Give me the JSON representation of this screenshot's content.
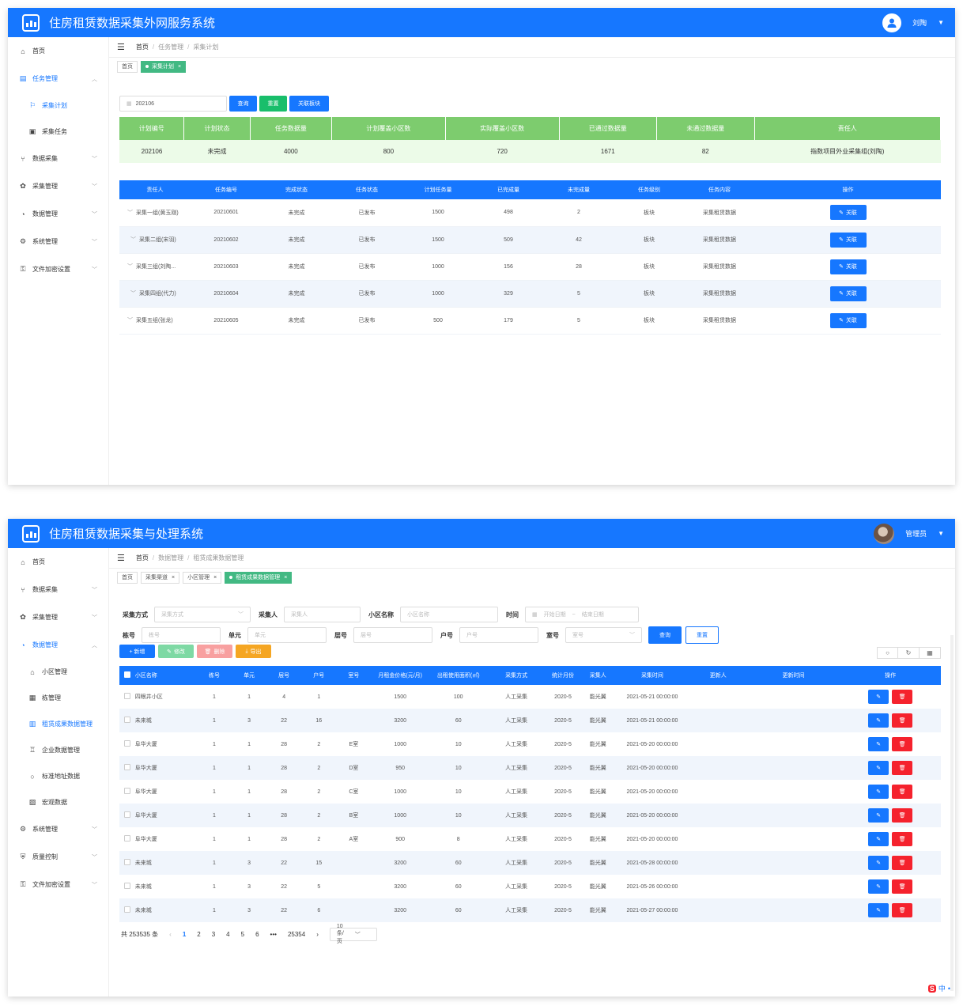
{
  "w1": {
    "title": "住房租赁数据采集外网服务系统",
    "user": "刘陶",
    "menu": [
      {
        "label": "首页",
        "icon": "home-icon",
        "glyph": "⌂"
      },
      {
        "label": "任务管理",
        "icon": "clipboard-icon",
        "glyph": "▤",
        "active": true,
        "chev": "︿"
      },
      {
        "label": "采集计划",
        "icon": "flag-icon",
        "glyph": "⚐",
        "sub": true,
        "active": true
      },
      {
        "label": "采集任务",
        "icon": "calendar-icon",
        "glyph": "▣",
        "sub": true
      },
      {
        "label": "数据采集",
        "icon": "branch-icon",
        "glyph": "⑂",
        "chev": "﹀"
      },
      {
        "label": "采集管理",
        "icon": "gear-icon",
        "glyph": "✿",
        "chev": "﹀"
      },
      {
        "label": "数据管理",
        "icon": "pie-icon",
        "glyph": "◔",
        "chev": "﹀"
      },
      {
        "label": "系统管理",
        "icon": "settings-icon",
        "glyph": "⚙",
        "chev": "﹀"
      },
      {
        "label": "文件加密设置",
        "icon": "lock-icon",
        "glyph": "⚿",
        "chev": "﹀"
      }
    ],
    "crumbs": [
      "首页",
      "任务管理",
      "采集计划"
    ],
    "tabs": [
      {
        "label": "首页"
      },
      {
        "label": "采集计划",
        "on": true
      }
    ],
    "search_value": "202106",
    "buttons": [
      "查询",
      "重置",
      "关联板块"
    ],
    "plan_headers": [
      "计划编号",
      "计划状态",
      "任务数据量",
      "计划覆盖小区数",
      "实际覆盖小区数",
      "已通过数据量",
      "未通过数据量",
      "责任人"
    ],
    "plan_row": [
      "202106",
      "未完成",
      "4000",
      "800",
      "720",
      "1671",
      "82",
      "指数项目外业采集组(刘陶)"
    ],
    "task_headers": [
      "责任人",
      "任务编号",
      "完成状态",
      "任务状态",
      "计划任务量",
      "已完成量",
      "未完成量",
      "任务级别",
      "任务内容",
      "操作"
    ],
    "task_rows": [
      [
        "采集一组(黄玉刚)",
        "20210601",
        "未完成",
        "已发布",
        "1500",
        "498",
        "2",
        "板块",
        "采集租赁数据"
      ],
      [
        "采集二组(宋羽)",
        "20210602",
        "未完成",
        "已发布",
        "1500",
        "509",
        "42",
        "板块",
        "采集租赁数据"
      ],
      [
        "采集三组(刘陶...",
        "20210603",
        "未完成",
        "已发布",
        "1000",
        "156",
        "28",
        "板块",
        "采集租赁数据"
      ],
      [
        "采集四组(代力)",
        "20210604",
        "未完成",
        "已发布",
        "1000",
        "329",
        "5",
        "板块",
        "采集租赁数据"
      ],
      [
        "采集五组(张龙)",
        "20210605",
        "未完成",
        "已发布",
        "500",
        "179",
        "5",
        "板块",
        "采集租赁数据"
      ]
    ],
    "action_label": "关联"
  },
  "w2": {
    "title": "住房租赁数据采集与处理系统",
    "user": "管理员",
    "menu": [
      {
        "label": "首页",
        "icon": "home-icon",
        "glyph": "⌂"
      },
      {
        "label": "数据采集",
        "icon": "branch-icon",
        "glyph": "⑂",
        "chev": "﹀"
      },
      {
        "label": "采集管理",
        "icon": "gear-icon",
        "glyph": "✿",
        "chev": "﹀"
      },
      {
        "label": "数据管理",
        "icon": "pie-icon",
        "glyph": "◔",
        "active": true,
        "chev": "︿"
      },
      {
        "label": "小区管理",
        "icon": "house-icon",
        "glyph": "⌂",
        "sub": true
      },
      {
        "label": "栋管理",
        "icon": "building-icon",
        "glyph": "▦",
        "sub": true
      },
      {
        "label": "租赁成果数据管理",
        "icon": "grid-icon",
        "glyph": "▥",
        "sub": true,
        "active": true
      },
      {
        "label": "企业数据管理",
        "icon": "company-icon",
        "glyph": "♖",
        "sub": true
      },
      {
        "label": "标准地址数据",
        "icon": "circle-icon",
        "glyph": "○",
        "sub": true
      },
      {
        "label": "宏观数据",
        "icon": "chart-icon",
        "glyph": "▨",
        "sub": true
      },
      {
        "label": "系统管理",
        "icon": "settings-icon",
        "glyph": "⚙",
        "chev": "﹀"
      },
      {
        "label": "质量控制",
        "icon": "shield-icon",
        "glyph": "⛨",
        "chev": "﹀"
      },
      {
        "label": "文件加密设置",
        "icon": "lock-icon",
        "glyph": "⚿",
        "chev": "﹀"
      }
    ],
    "crumbs": [
      "首页",
      "数据管理",
      "租赁成果数据管理"
    ],
    "tabs": [
      {
        "label": "首页"
      },
      {
        "label": "采集渠道",
        "x": true
      },
      {
        "label": "小区管理",
        "x": true
      },
      {
        "label": "租赁成果数据管理",
        "on": true
      }
    ],
    "filters": {
      "mode_label": "采集方式",
      "mode_ph": "采集方式",
      "collector_label": "采集人",
      "collector_ph": "采集人",
      "community_label": "小区名称",
      "community_ph": "小区名称",
      "time_label": "时间",
      "start_ph": "开始日期",
      "end_ph": "结束日期",
      "range_sep": "~",
      "building_label": "栋号",
      "building_ph": "栋号",
      "unit_label": "单元",
      "unit_ph": "单元",
      "floor_label": "层号",
      "floor_ph": "层号",
      "door_label": "户号",
      "door_ph": "户号",
      "room_label": "室号",
      "room_ph": "室号",
      "query": "查询",
      "reset": "重置"
    },
    "tools": {
      "add": "+ 新增",
      "edit": "修改",
      "delete": "删除",
      "export": "导出"
    },
    "headers": [
      "小区名称",
      "栋号",
      "单元",
      "层号",
      "户号",
      "室号",
      "月租金价格(元/月)",
      "出租使用面积(㎡)",
      "采集方式",
      "统计月份",
      "采集人",
      "采集时间",
      "更新人",
      "更新时间",
      "操作"
    ],
    "rows": [
      [
        "四眼井小区",
        "1",
        "1",
        "4",
        "1",
        "",
        "1500",
        "100",
        "人工采集",
        "2020-5",
        "能光翼",
        "2021-05-21 00:00:00"
      ],
      [
        "未来城",
        "1",
        "3",
        "22",
        "16",
        "",
        "3200",
        "60",
        "人工采集",
        "2020-5",
        "能光翼",
        "2021-05-21 00:00:00"
      ],
      [
        "阜华大厦",
        "1",
        "1",
        "28",
        "2",
        "E室",
        "1000",
        "10",
        "人工采集",
        "2020-5",
        "能光翼",
        "2021-05-20 00:00:00"
      ],
      [
        "阜华大厦",
        "1",
        "1",
        "28",
        "2",
        "D室",
        "950",
        "10",
        "人工采集",
        "2020-5",
        "能光翼",
        "2021-05-20 00:00:00"
      ],
      [
        "阜华大厦",
        "1",
        "1",
        "28",
        "2",
        "C室",
        "1000",
        "10",
        "人工采集",
        "2020-5",
        "能光翼",
        "2021-05-20 00:00:00"
      ],
      [
        "阜华大厦",
        "1",
        "1",
        "28",
        "2",
        "B室",
        "1000",
        "10",
        "人工采集",
        "2020-5",
        "能光翼",
        "2021-05-20 00:00:00"
      ],
      [
        "阜华大厦",
        "1",
        "1",
        "28",
        "2",
        "A室",
        "900",
        "8",
        "人工采集",
        "2020-5",
        "能光翼",
        "2021-05-20 00:00:00"
      ],
      [
        "未来城",
        "1",
        "3",
        "22",
        "15",
        "",
        "3200",
        "60",
        "人工采集",
        "2020-5",
        "能光翼",
        "2021-05-28 00:00:00"
      ],
      [
        "未来城",
        "1",
        "3",
        "22",
        "5",
        "",
        "3200",
        "60",
        "人工采集",
        "2020-5",
        "能光翼",
        "2021-05-26 00:00:00"
      ],
      [
        "未来城",
        "1",
        "3",
        "22",
        "6",
        "",
        "3200",
        "60",
        "人工采集",
        "2020-5",
        "能光翼",
        "2021-05-27 00:00:00"
      ]
    ],
    "pagination": {
      "total": "共 253535 条",
      "prev": "‹",
      "pages": [
        "1",
        "2",
        "3",
        "4",
        "5",
        "6"
      ],
      "ellipsis": "•••",
      "last": "25354",
      "next": "›",
      "size": "10条/页",
      "current": "1"
    }
  },
  "ime": "中",
  "colors": {
    "primary": "#1677ff",
    "green": "#42b983",
    "plan_header": "#7dcc6e",
    "danger": "#f5222d"
  }
}
